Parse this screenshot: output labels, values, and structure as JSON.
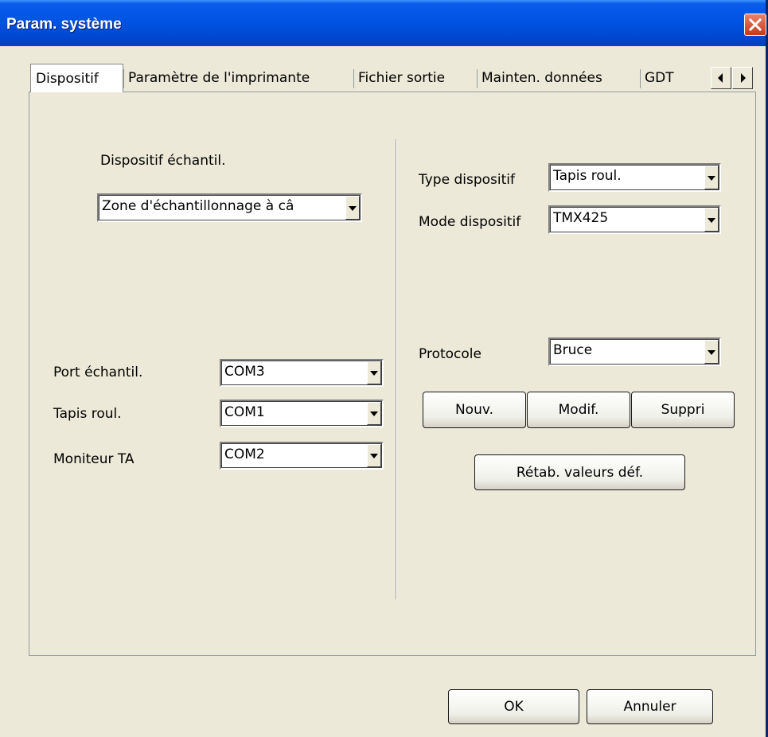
{
  "window": {
    "title": "Param. système"
  },
  "tabs": [
    "Dispositif",
    "Paramètre de l'imprimante",
    "Fichier sortie",
    "Mainten. données",
    "GDT"
  ],
  "left": {
    "sample_device_label": "Dispositif échantil.",
    "sample_device_value": "Zone d'échantillonnage à câ",
    "ports": [
      {
        "label": "Port échantil.",
        "value": "COM3"
      },
      {
        "label": "Tapis roul.",
        "value": "COM1"
      },
      {
        "label": "Moniteur TA",
        "value": "COM2"
      }
    ]
  },
  "right": {
    "device_type_label": "Type dispositif",
    "device_type_value": "Tapis roul.",
    "device_mode_label": "Mode dispositif",
    "device_mode_value": "TMX425",
    "protocol_label": "Protocole",
    "protocol_value": "Bruce",
    "new_label": "Nouv.",
    "modify_label": "Modif.",
    "delete_label": "Suppri",
    "reset_label": "Rétab. valeurs déf."
  },
  "footer": {
    "ok_label": "OK",
    "cancel_label": "Annuler"
  }
}
